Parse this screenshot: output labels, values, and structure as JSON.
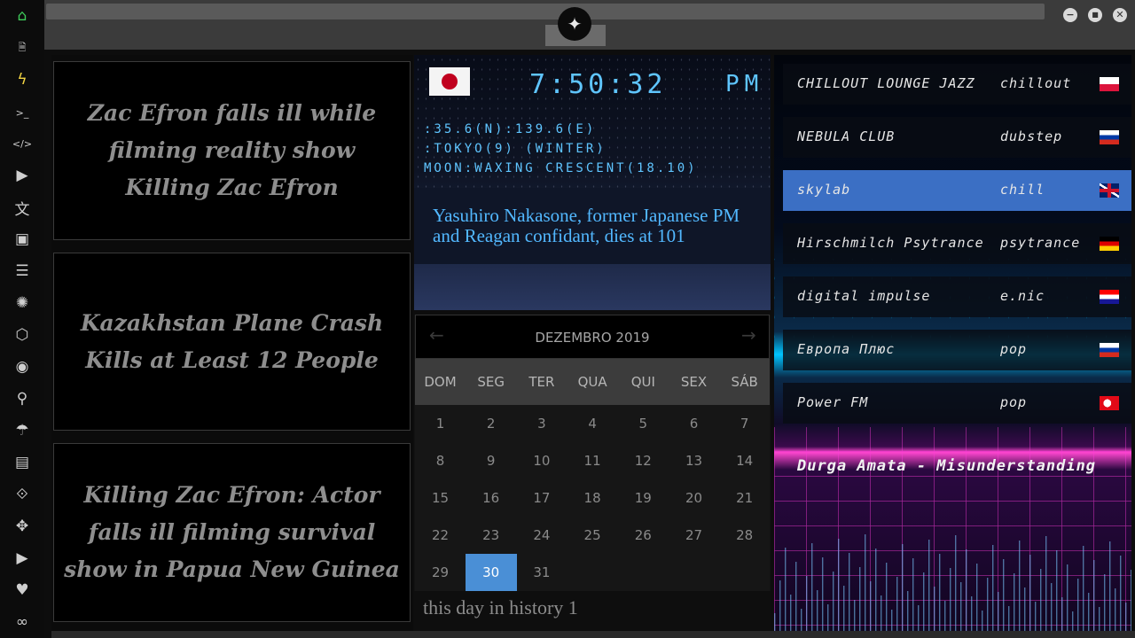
{
  "sidebar": {
    "items": [
      {
        "name": "home-icon",
        "glyph": "⌂"
      },
      {
        "name": "document-icon",
        "glyph": "🗎"
      },
      {
        "name": "lightning-icon",
        "glyph": "ϟ"
      },
      {
        "name": "terminal-icon",
        "glyph": ">_"
      },
      {
        "name": "code-icon",
        "glyph": "</>"
      },
      {
        "name": "play-icon",
        "glyph": "▶"
      },
      {
        "name": "translate-icon",
        "glyph": "文"
      },
      {
        "name": "image-icon",
        "glyph": "▣"
      },
      {
        "name": "newspaper-icon",
        "glyph": "☰"
      },
      {
        "name": "empire-icon",
        "glyph": "✺"
      },
      {
        "name": "hexagon-icon",
        "glyph": "⬡"
      },
      {
        "name": "globe-icon",
        "glyph": "◉"
      },
      {
        "name": "search-icon",
        "glyph": "⚲"
      },
      {
        "name": "umbrella-icon",
        "glyph": "☂"
      },
      {
        "name": "contacts-icon",
        "glyph": "▤"
      },
      {
        "name": "link-icon",
        "glyph": "⟐"
      },
      {
        "name": "expand-icon",
        "glyph": "✥"
      },
      {
        "name": "youtube-icon",
        "glyph": "▶"
      },
      {
        "name": "heart-icon",
        "glyph": "♥"
      },
      {
        "name": "infinity-icon",
        "glyph": "∞"
      }
    ]
  },
  "window": {
    "logo_glyph": "✦",
    "buttons": [
      "−",
      "■",
      "✕"
    ]
  },
  "news": {
    "items": [
      {
        "title": "Zac Efron falls ill while filming reality show Killing Zac Efron"
      },
      {
        "title": "Kazakhstan Plane Crash Kills at Least 12 People"
      },
      {
        "title": "Killing Zac Efron: Actor falls ill filming survival show in Papua New Guinea"
      }
    ]
  },
  "clock": {
    "time": "7:50:32",
    "ampm": "PM",
    "coords": ":35.6(N):139.6(E)",
    "location": ":TOKYO(9) (WINTER)",
    "moon": "MOON:WAXING CRESCENT(18.10)",
    "headline": "Yasuhiro Nakasone, former Japanese PM and Reagan confidant, dies at 101",
    "flag_colors": {
      "bg": "#f4f4f4",
      "disc": "#c0001e"
    }
  },
  "calendar": {
    "title": "DEZEMBRO 2019",
    "prev": "←",
    "next": "→",
    "days": [
      "DOM",
      "SEG",
      "TER",
      "QUA",
      "QUI",
      "SEX",
      "SÁB"
    ],
    "weeks": [
      [
        "1",
        "2",
        "3",
        "4",
        "5",
        "6",
        "7"
      ],
      [
        "8",
        "9",
        "10",
        "11",
        "12",
        "13",
        "14"
      ],
      [
        "15",
        "16",
        "17",
        "18",
        "19",
        "20",
        "21"
      ],
      [
        "22",
        "23",
        "24",
        "25",
        "26",
        "27",
        "28"
      ],
      [
        "29",
        "30",
        "31",
        "",
        "",
        "",
        ""
      ]
    ],
    "selected": "30",
    "history": "this day in history 1"
  },
  "radio": {
    "stations": [
      {
        "name": "CHILLOUT LOUNGE JAZZ",
        "genre": "chillout",
        "flag": "pl"
      },
      {
        "name": "NEBULA CLUB",
        "genre": "dubstep",
        "flag": "ru"
      },
      {
        "name": "skylab",
        "genre": "chill",
        "flag": "gb",
        "active": true
      },
      {
        "name": "Hirschmilch Psytrance",
        "genre": "psytrance",
        "flag": "de"
      },
      {
        "name": "digital impulse",
        "genre": "e.nic",
        "flag": "hr"
      },
      {
        "name": "Европа Плюс",
        "genre": "pop",
        "flag": "ru"
      },
      {
        "name": "Power FM",
        "genre": "pop",
        "flag": "tr"
      }
    ],
    "now_playing": "Durga Amata - Misunderstanding",
    "accent": "#3b6fc4"
  }
}
